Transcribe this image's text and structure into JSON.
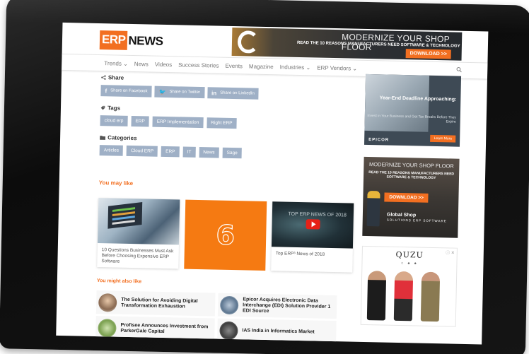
{
  "brand": {
    "erp": "ERP",
    "news": "NEWS"
  },
  "top_banner": {
    "headline": "MODERNIZE YOUR SHOP FLOOR",
    "sub": "READ THE 10 REASONS MANUFACTURERS NEED SOFTWARE & TECHNOLOGY",
    "cta": "DOWNLOAD >>"
  },
  "nav": {
    "items": [
      "Trends ⌄",
      "News",
      "Videos",
      "Success Stories",
      "Events",
      "Magazine",
      "Industries ⌄",
      "ERP Vendors ⌄"
    ],
    "search_icon": "🔍"
  },
  "share": {
    "title": "Share",
    "buttons": [
      {
        "icon": "f",
        "label": "Share on Facebook"
      },
      {
        "icon": "🐦",
        "label": "Share on Twitter"
      },
      {
        "icon": "in",
        "label": "Share on LinkedIn"
      }
    ]
  },
  "tags": {
    "title": "Tags",
    "items": [
      "cloud erp",
      "ERP",
      "ERP Implementation",
      "Right ERP"
    ]
  },
  "categories": {
    "title": "Categories",
    "items": [
      "Articles",
      "Cloud ERP",
      "ERP",
      "IT",
      "News",
      "Sage"
    ]
  },
  "you_may_like": {
    "title": "You may like",
    "cards": [
      {
        "caption": "10 Questions Businesses Must Ask Before Choosing Expensive ERP Software"
      },
      {
        "number": "6"
      },
      {
        "caption": "Top ERP³ News of 2018",
        "thumb_title": "TOP ERP NEWS OF 2018"
      }
    ]
  },
  "might_like": {
    "title": "You might also like",
    "items": [
      {
        "text": "The Solution for Avoiding Digital Transformation Exhaustion"
      },
      {
        "text": "Epicor Acquires Electronic Data Interchange (EDI) Solution Provider 1 EDI Source"
      },
      {
        "text": "Profisee Announces Investment from ParkerGale Capital"
      },
      {
        "text": "IAS India in Informatics Market"
      }
    ]
  },
  "sidebar": {
    "ad1": {
      "headline": "Year-End Deadline Approaching:",
      "body": "Invest in Your Business and Get Tax Breaks Before They Expire",
      "logo": "EPICOR",
      "cta": "Learn More"
    },
    "ad2": {
      "headline": "MODERNIZE YOUR SHOP FLOOR",
      "sub": "READ THE 10 REASONS MANUFACTURERS NEED SOFTWARE & TECHNOLOGY",
      "cta": "DOWNLOAD >>",
      "logo": "Global Shop",
      "logo_sub": "SOLUTIONS ERP SOFTWARE"
    },
    "ad3": {
      "brand": "QUZU",
      "close": "ⓘ ✕",
      "dots": "○ ● ●"
    }
  }
}
